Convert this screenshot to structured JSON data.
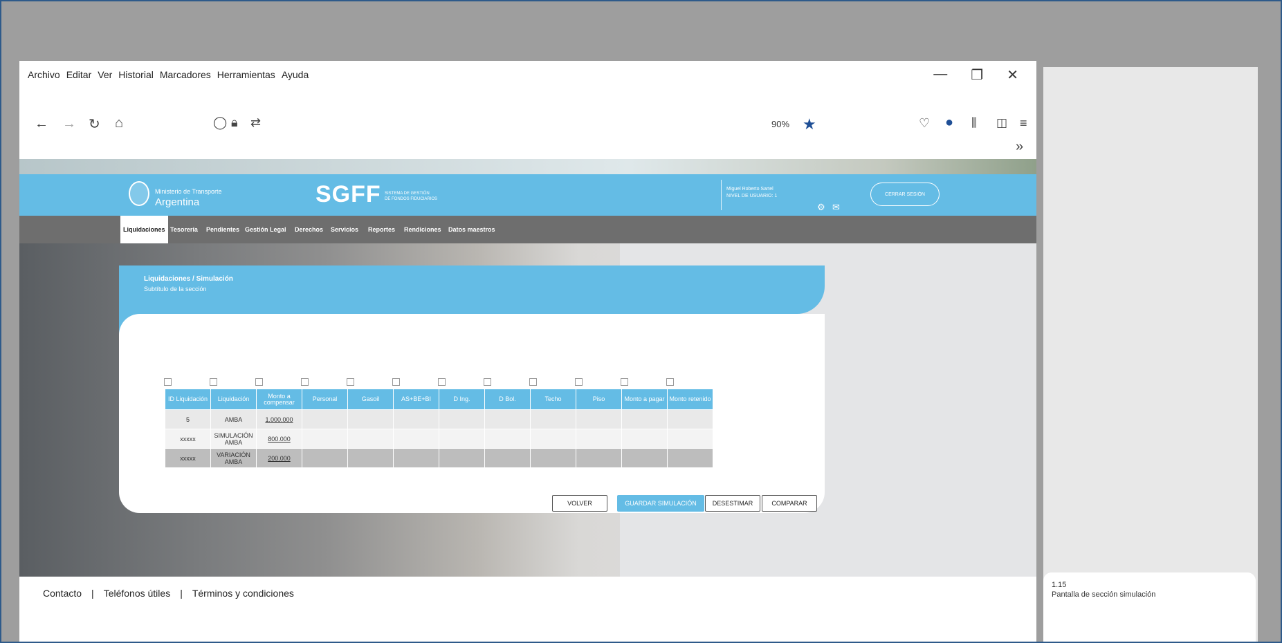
{
  "browser": {
    "menu": [
      "Archivo",
      "Editar",
      "Ver",
      "Historial",
      "Marcadores",
      "Herramientas",
      "Ayuda"
    ],
    "window_controls": [
      "—",
      "❐",
      "✕"
    ],
    "zoom": "90%",
    "overflow": "»"
  },
  "site": {
    "ministry_line1": "Ministerio de Transporte",
    "ministry_line2": "Argentina",
    "system_name": "SGFF",
    "system_sub1": "SISTEMA DE GESTIÓN",
    "system_sub2": "DE FONDOS FIDUCIARIOS",
    "user_name": "Miguel Roberto Sartel",
    "user_level": "NIVEL DE USUARIO: 1",
    "logout": "CERRAR SESIÓN",
    "nav": [
      "Liquidaciones",
      "Tesorería",
      "Pendientes",
      "Gestión Legal",
      "Derechos",
      "Servicios",
      "Reportes",
      "Rendiciones",
      "Datos maestros"
    ]
  },
  "section": {
    "breadcrumb": "Liquidaciones  /  Simulación",
    "subtitle": "Subtítulo de la sección"
  },
  "table": {
    "headers": [
      "ID Liquidación",
      "Liquidación",
      "Monto a compensar",
      "Personal",
      "Gasoil",
      "AS+BE+BI",
      "D Ing.",
      "D Bol.",
      "Techo",
      "Piso",
      "Monto a pagar",
      "Monto retenido"
    ],
    "rows": [
      [
        "5",
        "AMBA",
        "1.000.000",
        "",
        "",
        "",
        "",
        "",
        "",
        "",
        "",
        ""
      ],
      [
        "xxxxx",
        "SIMULACIÓN AMBA",
        "800.000",
        "",
        "",
        "",
        "",
        "",
        "",
        "",
        "",
        ""
      ],
      [
        "xxxxx",
        "VARIACIÓN AMBA",
        "200.000",
        "",
        "",
        "",
        "",
        "",
        "",
        "",
        "",
        ""
      ]
    ]
  },
  "buttons": {
    "back": "VOLVER",
    "save": "GUARDAR SIMULACIÓN",
    "discard": "DESESTIMAR",
    "compare": "COMPARAR"
  },
  "footer": {
    "contact": "Contacto",
    "phones": "Teléfonos útiles",
    "terms": "Términos y condiciones",
    "separator": "|"
  },
  "note": {
    "number": "1.15",
    "text": "Pantalla de sección simulación"
  },
  "colors": {
    "accent": "#64bce5",
    "navbar": "#6e6e6e"
  }
}
